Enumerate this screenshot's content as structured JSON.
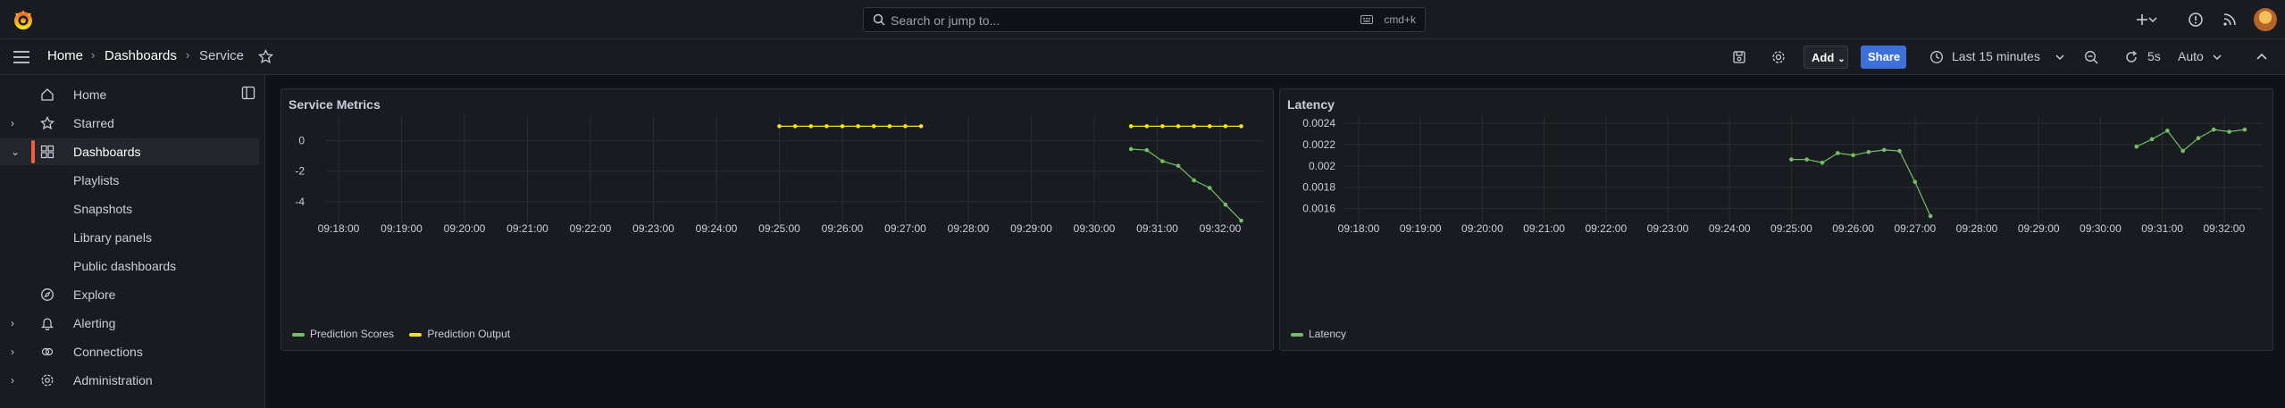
{
  "topbar": {
    "search_placeholder": "Search or jump to...",
    "search_shortcut": "cmd+k",
    "icons": [
      "grafana-logo-icon",
      "plus-icon",
      "chevron-down-icon",
      "help-icon",
      "rss-icon",
      "avatar"
    ]
  },
  "navbar": {
    "breadcrumb": [
      "Home",
      "Dashboards",
      "Service"
    ],
    "add_label": "Add",
    "share_label": "Share",
    "time_range": "Last 15 minutes",
    "refresh_interval": "5s",
    "auto_label": "Auto"
  },
  "sidebar": {
    "items": [
      {
        "label": "Home",
        "icon": "home-icon"
      },
      {
        "label": "Starred",
        "icon": "star-icon"
      },
      {
        "label": "Dashboards",
        "icon": "apps-icon"
      },
      {
        "label": "Playlists"
      },
      {
        "label": "Snapshots"
      },
      {
        "label": "Library panels"
      },
      {
        "label": "Public dashboards"
      },
      {
        "label": "Explore",
        "icon": "compass-icon"
      },
      {
        "label": "Alerting",
        "icon": "bell-icon"
      },
      {
        "label": "Connections",
        "icon": "connections-icon"
      },
      {
        "label": "Administration",
        "icon": "cog-icon"
      }
    ]
  },
  "colors": {
    "green": "#73bf69",
    "yellow": "#fade2a",
    "accent": "#f55f3e",
    "share": "#3d71d9"
  },
  "chart_data": [
    {
      "type": "line",
      "title": "Service Metrics",
      "x_ticks": [
        "09:18:00",
        "09:19:00",
        "09:20:00",
        "09:21:00",
        "09:22:00",
        "09:23:00",
        "09:24:00",
        "09:25:00",
        "09:26:00",
        "09:27:00",
        "09:28:00",
        "09:29:00",
        "09:30:00",
        "09:31:00",
        "09:32:00"
      ],
      "y_ticks": [
        0,
        -2,
        -4
      ],
      "ylim": [
        -5.3,
        1.5
      ],
      "legend_position": "bottom-left",
      "series": [
        {
          "name": "Prediction Scores",
          "color": "#73bf69",
          "points": [
            [
              "09:30:35",
              -0.55
            ],
            [
              "09:30:50",
              -0.62
            ],
            [
              "09:31:05",
              -1.35
            ],
            [
              "09:31:20",
              -1.65
            ],
            [
              "09:31:35",
              -2.6
            ],
            [
              "09:31:50",
              -3.1
            ],
            [
              "09:32:05",
              -4.2
            ],
            [
              "09:32:20",
              -5.25
            ]
          ]
        },
        {
          "name": "Prediction Output",
          "color": "#fade2a",
          "points": [
            [
              "09:25:00",
              0.95
            ],
            [
              "09:25:15",
              0.95
            ],
            [
              "09:25:30",
              0.95
            ],
            [
              "09:25:45",
              0.95
            ],
            [
              "09:26:00",
              0.95
            ],
            [
              "09:26:15",
              0.95
            ],
            [
              "09:26:30",
              0.95
            ],
            [
              "09:26:45",
              0.95
            ],
            [
              "09:27:00",
              0.95
            ],
            [
              "09:27:15",
              0.95
            ],
            [
              "09:30:35",
              0.95
            ],
            [
              "09:30:50",
              0.95
            ],
            [
              "09:31:05",
              0.95
            ],
            [
              "09:31:20",
              0.95
            ],
            [
              "09:31:35",
              0.95
            ],
            [
              "09:31:50",
              0.95
            ],
            [
              "09:32:05",
              0.95
            ],
            [
              "09:32:20",
              0.95
            ]
          ]
        }
      ]
    },
    {
      "type": "line",
      "title": "Latency",
      "x_ticks": [
        "09:18:00",
        "09:19:00",
        "09:20:00",
        "09:21:00",
        "09:22:00",
        "09:23:00",
        "09:24:00",
        "09:25:00",
        "09:26:00",
        "09:27:00",
        "09:28:00",
        "09:29:00",
        "09:30:00",
        "09:31:00",
        "09:32:00"
      ],
      "y_ticks": [
        "0.0024",
        "0.0022",
        "0.002",
        "0.0018",
        "0.0016"
      ],
      "ylim": [
        0.00148,
        0.00245
      ],
      "legend_position": "bottom-left",
      "series": [
        {
          "name": "Latency",
          "color": "#73bf69",
          "points": [
            [
              "09:25:00",
              0.00206
            ],
            [
              "09:25:15",
              0.00206
            ],
            [
              "09:25:30",
              0.00203
            ],
            [
              "09:25:45",
              0.00212
            ],
            [
              "09:26:00",
              0.0021
            ],
            [
              "09:26:15",
              0.00213
            ],
            [
              "09:26:30",
              0.00215
            ],
            [
              "09:26:45",
              0.00214
            ],
            [
              "09:27:00",
              0.00185
            ],
            [
              "09:27:15",
              0.00153
            ],
            [
              "09:30:35",
              0.00218
            ],
            [
              "09:30:50",
              0.00225
            ],
            [
              "09:31:05",
              0.00233
            ],
            [
              "09:31:20",
              0.00214
            ],
            [
              "09:31:35",
              0.00226
            ],
            [
              "09:31:50",
              0.00234
            ],
            [
              "09:32:05",
              0.00232
            ],
            [
              "09:32:20",
              0.00234
            ]
          ]
        }
      ]
    }
  ]
}
